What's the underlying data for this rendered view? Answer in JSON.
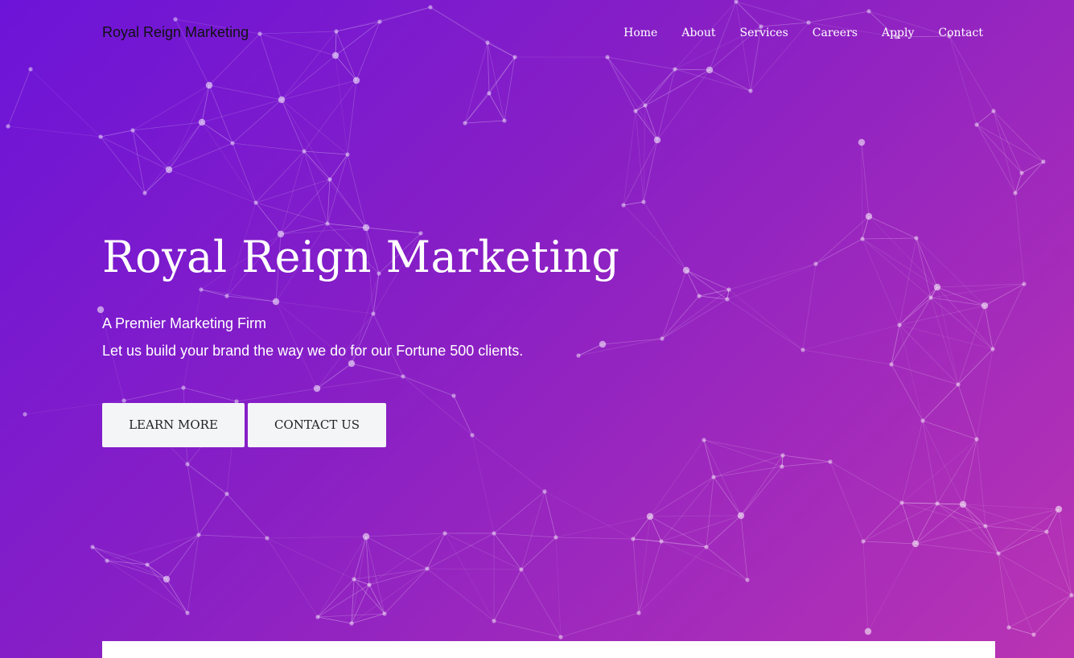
{
  "brand": "Royal Reign Marketing",
  "nav": {
    "items": [
      "Home",
      "About",
      "Services",
      "Careers",
      "Apply",
      "Contact"
    ]
  },
  "hero": {
    "title": "Royal Reign Marketing",
    "subtitle": "A Premier Marketing Firm",
    "text": "Let us build your brand the way we do for our Fortune 500 clients.",
    "learn_more": "LEARN MORE",
    "contact_us": "CONTACT US"
  },
  "colors": {
    "gradient_start": "#6c14d8",
    "gradient_mid": "#8a20c4",
    "gradient_end": "#b934b3",
    "button_bg": "#f4f5f7",
    "network_lines": "#ffffff"
  },
  "background_icon": "particle-network"
}
